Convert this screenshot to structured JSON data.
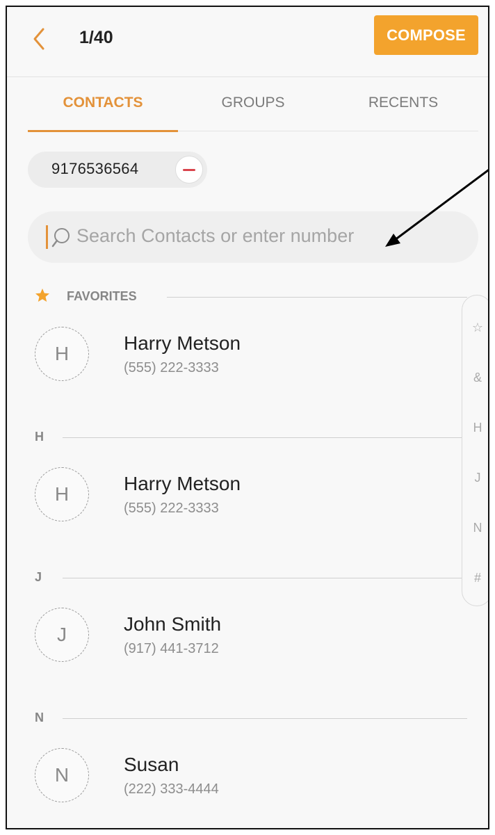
{
  "header": {
    "counter": "1/40",
    "compose_label": "COMPOSE",
    "back_icon": "chevron-left-icon"
  },
  "tabs": [
    {
      "label": "CONTACTS",
      "active": true
    },
    {
      "label": "GROUPS",
      "active": false
    },
    {
      "label": "RECENTS",
      "active": false
    }
  ],
  "recipient_chip": {
    "number": "9176536564",
    "remove_icon": "minus-circle-icon"
  },
  "search": {
    "placeholder": "Search Contacts or enter number",
    "icon": "search-icon"
  },
  "sections": {
    "favorites": "FAVORITES",
    "h": "H",
    "j": "J",
    "n": "N"
  },
  "contacts": [
    {
      "initial": "H",
      "name": "Harry Metson",
      "phone": "(555) 222-3333"
    },
    {
      "initial": "H",
      "name": "Harry Metson",
      "phone": "(555) 222-3333"
    },
    {
      "initial": "J",
      "name": "John Smith",
      "phone": "(917) 441-3712"
    },
    {
      "initial": "N",
      "name": "Susan",
      "phone": "(222) 333-4444"
    }
  ],
  "index_bar": [
    "☆",
    "&",
    "H",
    "J",
    "N",
    "#"
  ],
  "colors": {
    "accent": "#f3a32d",
    "tab_active": "#e3923a",
    "remove": "#d9444c"
  }
}
